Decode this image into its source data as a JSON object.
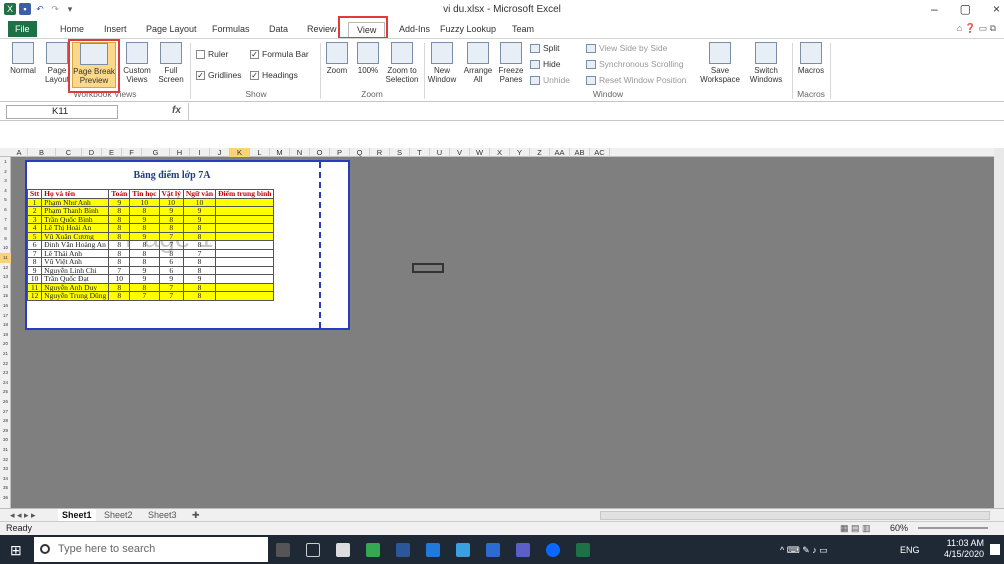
{
  "window": {
    "title": "vi du.xlsx - Microsoft Excel"
  },
  "qat": {
    "icons": [
      "excel-logo-icon",
      "save-icon",
      "undo-icon",
      "redo-icon",
      "customize-qat-icon"
    ]
  },
  "tabs": [
    {
      "label": "File"
    },
    {
      "label": "Home"
    },
    {
      "label": "Insert"
    },
    {
      "label": "Page Layout"
    },
    {
      "label": "Formulas"
    },
    {
      "label": "Data"
    },
    {
      "label": "Review"
    },
    {
      "label": "View"
    },
    {
      "label": "Add-Ins"
    },
    {
      "label": "Fuzzy Lookup"
    },
    {
      "label": "Team"
    }
  ],
  "ribbon": {
    "workbook_views": {
      "group": "Workbook Views",
      "normal": "Normal",
      "page_layout": "Page Layout",
      "page_break": "Page Break Preview",
      "custom_views": "Custom Views",
      "full_screen": "Full Screen"
    },
    "show": {
      "group": "Show",
      "ruler": "Ruler",
      "formula_bar": "Formula Bar",
      "gridlines": "Gridlines",
      "headings": "Headings"
    },
    "zoom": {
      "group": "Zoom",
      "zoom": "Zoom",
      "zoom100": "100%",
      "zoom_to_selection": "Zoom to Selection"
    },
    "window": {
      "group": "Window",
      "new_window": "New Window",
      "arrange_all": "Arrange All",
      "freeze_panes": "Freeze Panes",
      "split": "Split",
      "hide": "Hide",
      "unhide": "Unhide",
      "view_side": "View Side by Side",
      "sync_scroll": "Synchronous Scrolling",
      "reset_pos": "Reset Window Position",
      "save_ws": "Save Workspace",
      "switch_win": "Switch Windows"
    },
    "macros": {
      "group": "Macros",
      "macros": "Macros"
    }
  },
  "formula_bar": {
    "name_box": "K11",
    "fx": "fx",
    "value": ""
  },
  "columns": [
    "A",
    "B",
    "C",
    "D",
    "E",
    "F",
    "G",
    "H",
    "I",
    "J",
    "K",
    "L",
    "M",
    "N",
    "O",
    "P",
    "Q",
    "R",
    "S",
    "T",
    "U",
    "V",
    "W",
    "X",
    "Y",
    "Z",
    "AA",
    "AB",
    "AC"
  ],
  "rows": [
    "1",
    "2",
    "3",
    "4",
    "5",
    "6",
    "7",
    "8",
    "9",
    "10",
    "11",
    "12",
    "13",
    "14",
    "15",
    "16",
    "17",
    "18",
    "19",
    "20",
    "21",
    "22",
    "23",
    "24",
    "25",
    "26",
    "27",
    "28",
    "29",
    "30",
    "31",
    "32",
    "33",
    "34",
    "35",
    "36"
  ],
  "sheet": {
    "title": "Bảng điểm lớp 7A",
    "watermark": "Page 1",
    "headers": [
      "Stt",
      "Họ và tên",
      "Toán",
      "Tin học",
      "Vật lý",
      "Ngữ văn",
      "Điểm trung bình"
    ],
    "rows": [
      [
        "1",
        "Phạm Như Anh",
        "9",
        "10",
        "10",
        "10"
      ],
      [
        "2",
        "Phạm Thanh Bình",
        "8",
        "8",
        "9",
        "9"
      ],
      [
        "3",
        "Trần Quốc Bình",
        "8",
        "9",
        "8",
        "9"
      ],
      [
        "4",
        "Lê Thị Hoài An",
        "8",
        "8",
        "8",
        "8"
      ],
      [
        "5",
        "Vũ Xuân Cương",
        "8",
        "9",
        "7",
        "8"
      ],
      [
        "6",
        "Đinh Văn Hoàng An",
        "8",
        "8",
        "7",
        "8"
      ],
      [
        "7",
        "Lê Thái Anh",
        "8",
        "8",
        "8",
        "7"
      ],
      [
        "8",
        "Vũ Việt Anh",
        "8",
        "8",
        "6",
        "8"
      ],
      [
        "9",
        "Nguyễn Linh Chi",
        "7",
        "9",
        "6",
        "8"
      ],
      [
        "10",
        "Trần Quốc Đạt",
        "10",
        "9",
        "9",
        "9"
      ],
      [
        "11",
        "Nguyễn Anh Duy",
        "8",
        "8",
        "7",
        "8"
      ],
      [
        "12",
        "Nguyễn Trung Dũng",
        "8",
        "7",
        "7",
        "8"
      ]
    ],
    "highlight_rows": [
      1,
      2,
      3,
      4,
      5,
      11,
      12
    ]
  },
  "sheet_tabs": [
    "Sheet1",
    "Sheet2",
    "Sheet3"
  ],
  "status": {
    "ready": "Ready",
    "zoom": "60%"
  },
  "taskbar": {
    "search_placeholder": "Type here to search",
    "lang": "ENG",
    "time": "11:03 AM",
    "date": "4/15/2020"
  },
  "colors": {
    "excel_green": "#1e7145",
    "highlight": "#ffff00",
    "page_border": "#2a3bbf",
    "callout": "#e03b3b"
  }
}
